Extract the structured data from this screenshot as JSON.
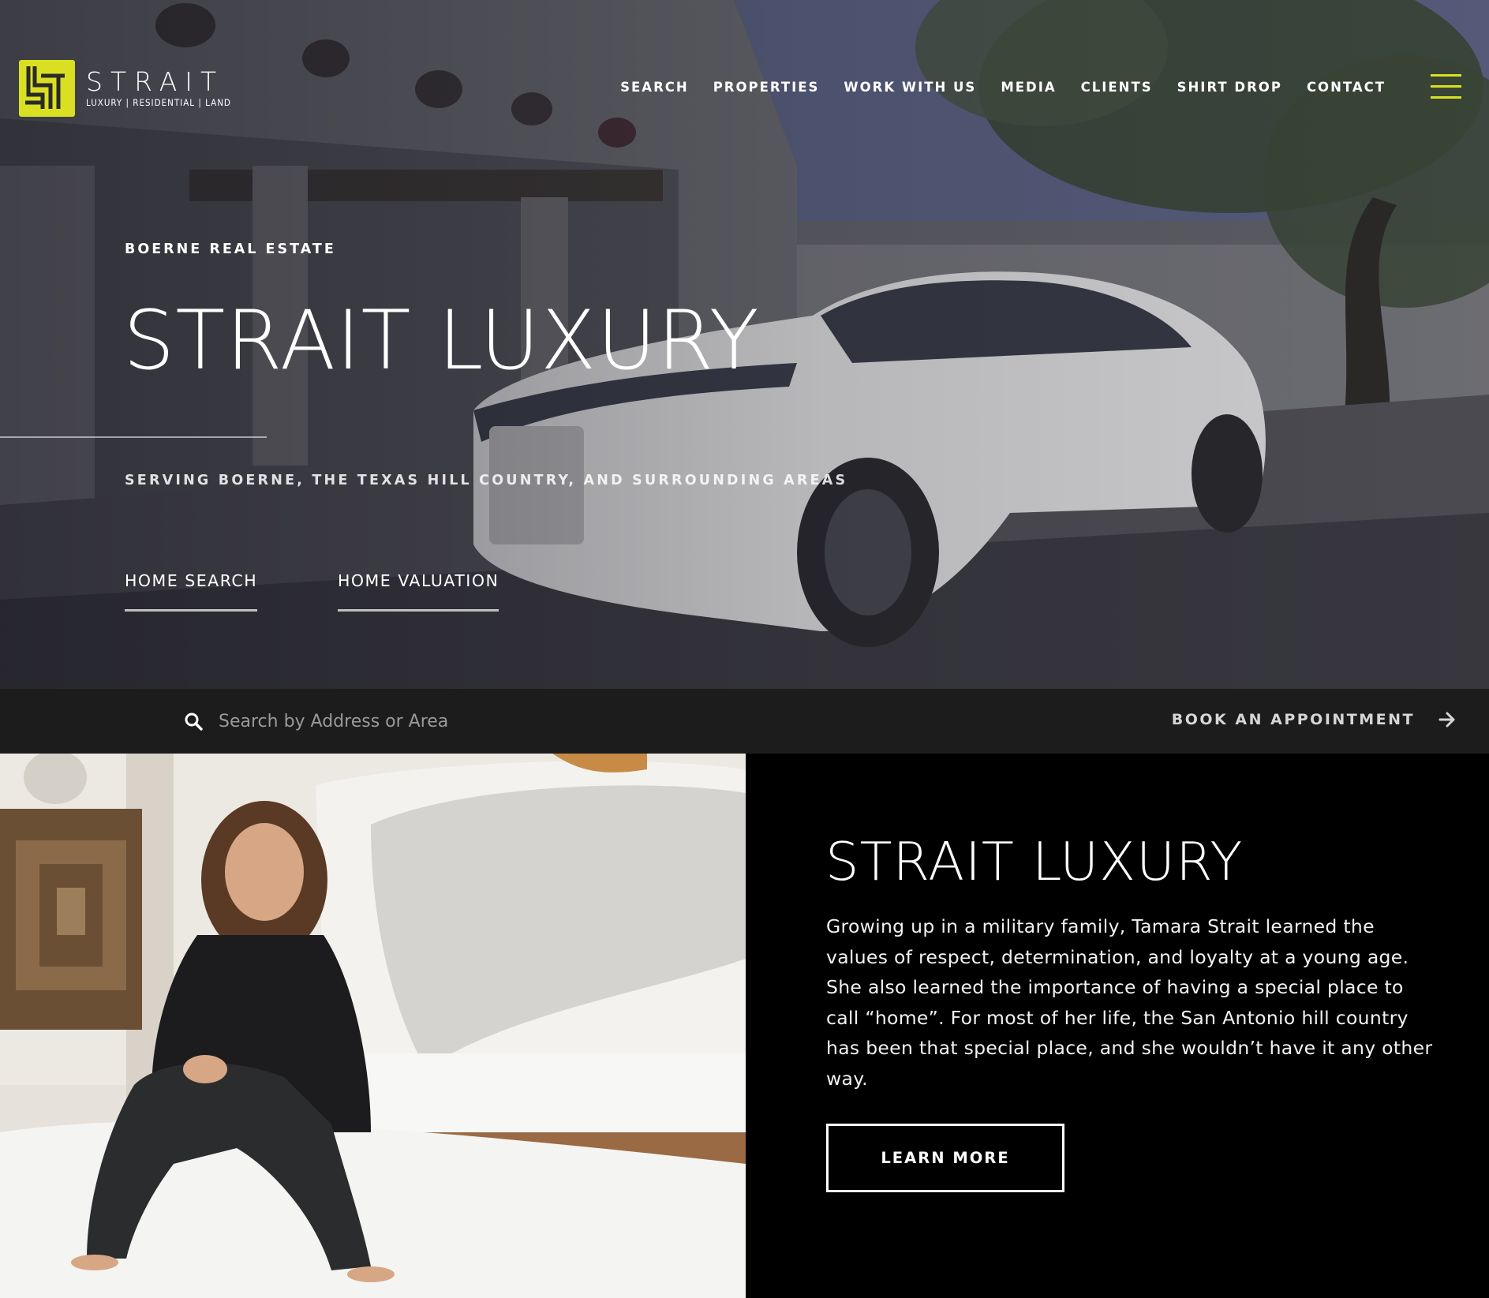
{
  "brand": {
    "name": "STRAIT",
    "tagline": "LUXURY | RESIDENTIAL | LAND",
    "accent_color": "#d9e021"
  },
  "nav": {
    "items": [
      {
        "label": "SEARCH"
      },
      {
        "label": "PROPERTIES"
      },
      {
        "label": "WORK WITH US"
      },
      {
        "label": "MEDIA"
      },
      {
        "label": "CLIENTS"
      },
      {
        "label": "SHIRT DROP"
      },
      {
        "label": "CONTACT"
      }
    ],
    "menu_icon": "hamburger-menu-icon"
  },
  "hero": {
    "eyebrow": "BOERNE REAL ESTATE",
    "title": "STRAIT LUXURY",
    "tagline": "SERVING BOERNE, THE TEXAS HILL COUNTRY, AND SURROUNDING AREAS",
    "cta_primary": "HOME SEARCH",
    "cta_secondary": "HOME VALUATION"
  },
  "search": {
    "placeholder": "Search by Address or Area",
    "value": "",
    "icon": "search-icon"
  },
  "appointment": {
    "label": "BOOK AN APPOINTMENT",
    "icon": "arrow-right-icon"
  },
  "about": {
    "title": "STRAIT LUXURY",
    "body": "Growing up in a military family, Tamara Strait learned the values of respect, determination, and loyalty at a young age. She also learned the importance of having a special place to call “home”. For most of her life, the San Antonio hill country has been that special place, and she wouldn’t have it any other way.",
    "button": "LEARN MORE"
  }
}
